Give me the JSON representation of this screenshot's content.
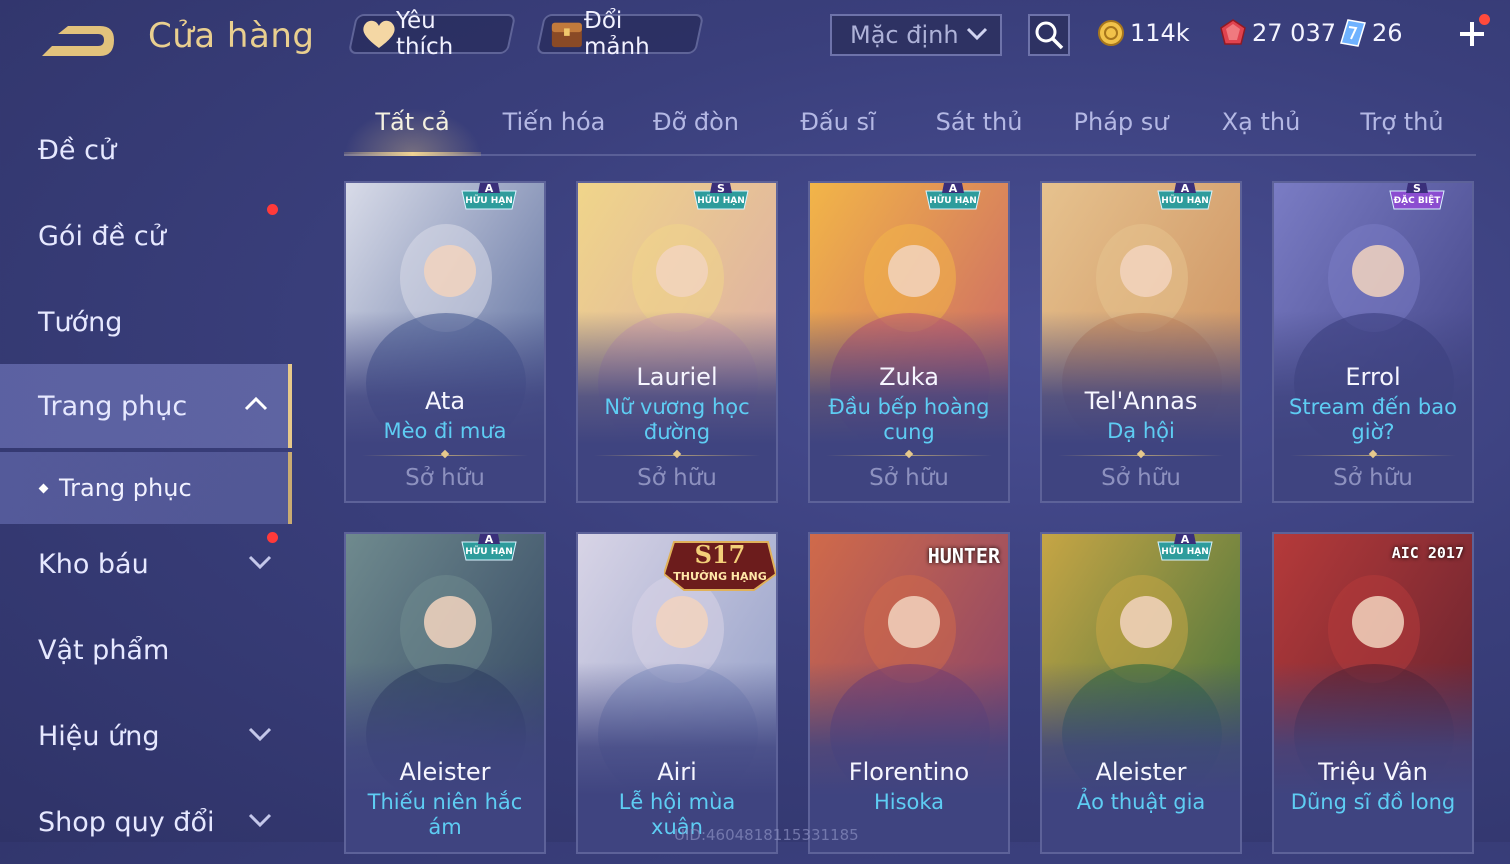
{
  "header": {
    "title": "Cửa hàng",
    "favorite_label": "Yêu thích",
    "exchange_label": "Đổi mảnh",
    "sort_value": "Mặc định",
    "gold": "114k",
    "ruby": "27 037",
    "gem": "26"
  },
  "sidebar": {
    "items": [
      {
        "label": "Đề cử"
      },
      {
        "label": "Gói đề cử"
      },
      {
        "label": "Tướng"
      },
      {
        "label": "Trang phục"
      },
      {
        "label": "Kho báu"
      },
      {
        "label": "Vật phẩm"
      },
      {
        "label": "Hiệu ứng"
      },
      {
        "label": "Shop quy đổi"
      }
    ],
    "sub_label": "Trang phục"
  },
  "tabs": [
    "Tất cả",
    "Tiến hóa",
    "Đỡ đòn",
    "Đấu sĩ",
    "Sát thủ",
    "Pháp sư",
    "Xạ thủ",
    "Trợ thủ"
  ],
  "cards": [
    {
      "hero": "Ata",
      "skin": "Mèo đi mưa",
      "owned": "Sở hữu",
      "badge_tier": "A",
      "badge_text": "HỮU HẠN",
      "palette": [
        "#4b5f94",
        "#d8dbe8"
      ]
    },
    {
      "hero": "Lauriel",
      "skin": "Nữ vương học đường",
      "owned": "Sở hữu",
      "badge_tier": "S",
      "badge_text": "HỮU HẠN",
      "palette": [
        "#d9a6a9",
        "#f0d58a"
      ]
    },
    {
      "hero": "Zuka",
      "skin": "Đầu bếp hoàng cung",
      "owned": "Sở hữu",
      "badge_tier": "A",
      "badge_text": "HỮU HẠN",
      "palette": [
        "#c45a6c",
        "#f2b548"
      ]
    },
    {
      "hero": "Tel'Annas",
      "skin": "Dạ hội",
      "owned": "Sở hữu",
      "badge_tier": "A",
      "badge_text": "HỮU HẠN",
      "palette": [
        "#c98a5a",
        "#e6c28e"
      ]
    },
    {
      "hero": "Errol",
      "skin": "Stream đến bao giờ?",
      "owned": "Sở hữu",
      "badge_tier": "S",
      "badge_text": "ĐẶC BIỆT",
      "palette": [
        "#3b3d7e",
        "#7a7cc4"
      ]
    },
    {
      "hero": "Aleister",
      "skin": "Thiếu niên hắc ám",
      "badge_tier": "A",
      "badge_text": "HỮU HẠN",
      "palette": [
        "#2b3d5c",
        "#6f8a8e"
      ]
    },
    {
      "hero": "Airi",
      "skin": "Lễ hội mùa xuân",
      "season_big": "S17",
      "season_small": "THƯỜNG HẠNG",
      "palette": [
        "#8a98c4",
        "#d8d4e6"
      ]
    },
    {
      "hero": "Florentino",
      "skin": "Hisoka",
      "logo": "HUNTER",
      "palette": [
        "#7d3d6e",
        "#d06a4a"
      ]
    },
    {
      "hero": "Aleister",
      "skin": "Ảo thuật gia",
      "badge_tier": "A",
      "badge_text": "HỮU HẠN",
      "palette": [
        "#2f6a3c",
        "#c6a545"
      ]
    },
    {
      "hero": "Triệu Vân",
      "skin": "Dũng sĩ đồ long",
      "logo": "AIC 2017",
      "palette": [
        "#5a1f2d",
        "#b53a3a"
      ]
    }
  ],
  "uid_text": "UID:4604818115331185",
  "colors": {
    "gold_text": "#e9cf8f",
    "skin_name": "#5ecdf3",
    "notification_dot": "#ff3a3a"
  }
}
